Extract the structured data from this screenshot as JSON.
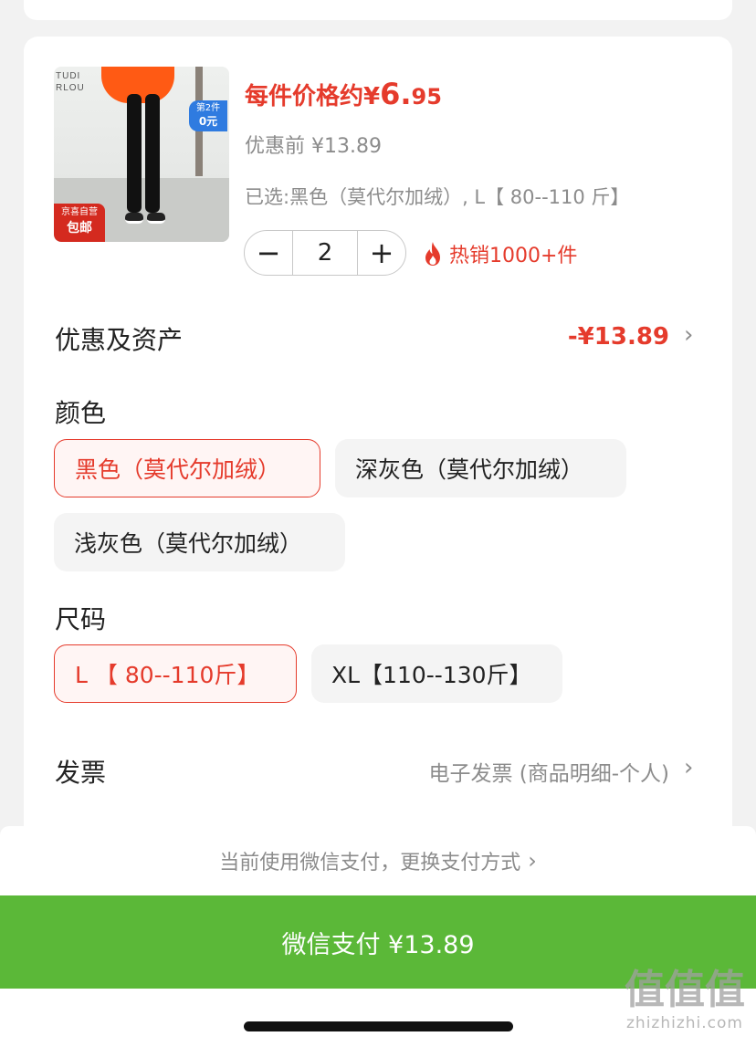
{
  "product": {
    "thumb_brand": "TUDI\nRLOU",
    "promo_line1": "第2件",
    "promo_line2": "0元",
    "badge_line1": "京喜自营",
    "badge_line2": "包邮",
    "price_prefix": "每件价格约¥",
    "price_int": "6.",
    "price_dec": "95",
    "original_price": "优惠前 ¥13.89",
    "selected_spec": "已选:黑色（莫代尔加绒）, L【 80--110 斤】",
    "quantity": "2",
    "hot_sales": "热销1000+件"
  },
  "discount": {
    "label": "优惠及资产",
    "value": "-¥13.89"
  },
  "color": {
    "label": "颜色",
    "options": [
      "黑色（莫代尔加绒）",
      "深灰色（莫代尔加绒）",
      "浅灰色（莫代尔加绒）"
    ],
    "selected_index": 0
  },
  "size": {
    "label": "尺码",
    "options": [
      "L 【 80--110斤】",
      "XL【110--130斤】"
    ],
    "selected_index": 0
  },
  "invoice": {
    "label": "发票",
    "value": "电子发票 (商品明细-个人)"
  },
  "payment": {
    "method_hint": "当前使用微信支付，更换支付方式",
    "pay_button": "微信支付 ¥13.89"
  },
  "watermark": {
    "glyphs": "值值值",
    "url": "zhizhizhi.com"
  },
  "icons": {
    "chevron": "›",
    "minus": "−",
    "plus": "+",
    "flame_color": "#e53b2c"
  },
  "colors": {
    "accent": "#e53b2c",
    "pay_green": "#5bb838"
  }
}
